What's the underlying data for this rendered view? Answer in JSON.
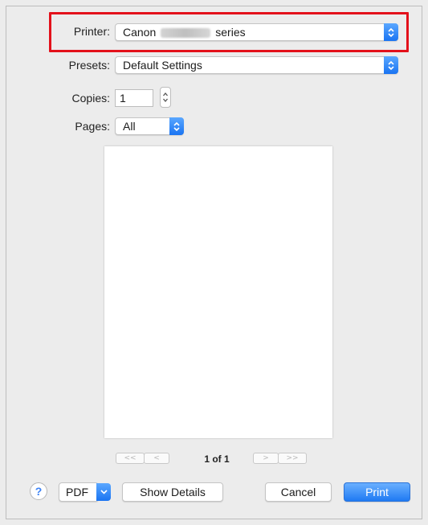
{
  "printer": {
    "label": "Printer:",
    "value_prefix": "Canon",
    "value_suffix": "series",
    "icon": "chevron-updown-icon"
  },
  "presets": {
    "label": "Presets:",
    "value": "Default Settings",
    "icon": "chevron-updown-icon"
  },
  "copies": {
    "label": "Copies:",
    "value": "1"
  },
  "pages": {
    "label": "Pages:",
    "value": "All"
  },
  "navigation": {
    "first": "<<",
    "prev": "<",
    "page_text": "1 of 1",
    "next": ">",
    "last": ">>"
  },
  "footer": {
    "help": "?",
    "pdf": "PDF",
    "show_details": "Show Details",
    "cancel": "Cancel",
    "print": "Print"
  },
  "colors": {
    "accent": "#1f7af3",
    "highlight": "#e3111b"
  }
}
